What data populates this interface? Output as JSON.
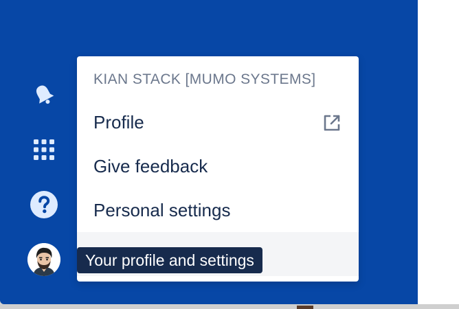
{
  "nav": {
    "icons": [
      "bell-icon",
      "app-switcher-icon",
      "help-icon"
    ],
    "avatar_alt": "user-avatar"
  },
  "menu": {
    "heading": "KIAN STACK [MUMO SYSTEMS]",
    "items": [
      {
        "label": "Profile",
        "external": true
      },
      {
        "label": "Give feedback",
        "external": false
      },
      {
        "label": "Personal settings",
        "external": false
      },
      {
        "label": "",
        "external": false
      }
    ]
  },
  "tooltip": {
    "text": "Your profile and settings"
  },
  "colors": {
    "nav_background": "#0747a6",
    "menu_text": "#172b4d",
    "menu_heading": "#6b778c",
    "tooltip_background": "#172b4d",
    "hover_background": "#f4f5f7"
  }
}
